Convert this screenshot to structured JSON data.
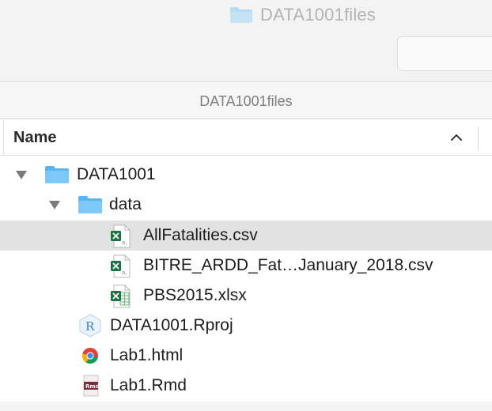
{
  "window": {
    "title": "DATA1001files",
    "title_icon": "folder-icon"
  },
  "pathbar": {
    "current": "DATA1001files"
  },
  "columns": {
    "name_header": "Name",
    "sort_icon": "chevron-up-icon"
  },
  "files": [
    {
      "label": "DATA1001",
      "kind": "folder",
      "expanded": true,
      "level": 0
    },
    {
      "label": "data",
      "kind": "folder",
      "expanded": true,
      "level": 1
    },
    {
      "label": "AllFatalities.csv",
      "kind": "csv",
      "level": 2,
      "selected": true
    },
    {
      "label": "BITRE_ARDD_Fat…January_2018.csv",
      "kind": "csv",
      "level": 2
    },
    {
      "label": "PBS2015.xlsx",
      "kind": "xlsx",
      "level": 2
    },
    {
      "label": "DATA1001.Rproj",
      "kind": "rproj",
      "level": 1
    },
    {
      "label": "Lab1.html",
      "kind": "html",
      "level": 1
    },
    {
      "label": "Lab1.Rmd",
      "kind": "rmd",
      "level": 1
    }
  ],
  "colors": {
    "folder": "#6cc1f7",
    "selection": "#e2e2e2",
    "excel_green": "#1e7145"
  }
}
